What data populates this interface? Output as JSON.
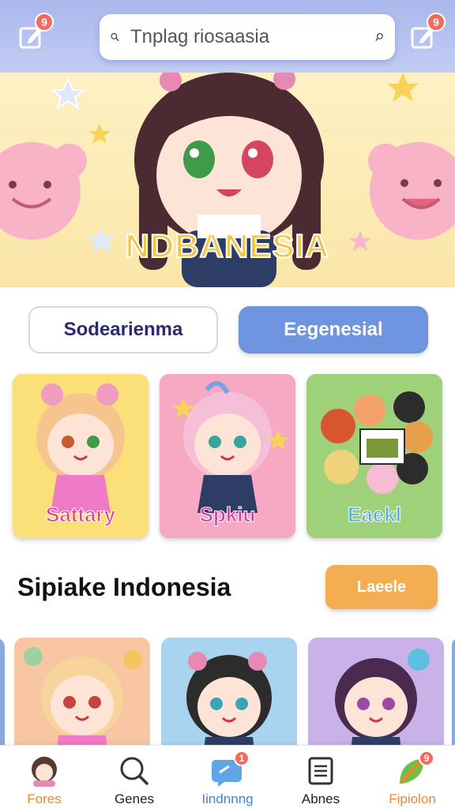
{
  "header": {
    "left_icon": "edit-icon",
    "left_badge": "9",
    "right_icon": "edit-icon",
    "right_badge": "9",
    "search_placeholder": "Tnplag riosaasia"
  },
  "banner": {
    "title": "NDBANESIA"
  },
  "tabs": [
    {
      "label": "Sodearienma",
      "active": false
    },
    {
      "label": "Eegenesial",
      "active": true
    }
  ],
  "featured": [
    {
      "label": "Sattary",
      "color": "#fbe07a"
    },
    {
      "label": "Spkiu",
      "color": "#f7a9c4"
    },
    {
      "label": "Eaekl",
      "color": "#9fd07a"
    }
  ],
  "section": {
    "title": "Sipiake Indonesia",
    "button": "Laeele"
  },
  "bottom_nav": [
    {
      "label": "Fores",
      "icon": "avatar-icon",
      "color": "#e88a2c"
    },
    {
      "label": "Genes",
      "icon": "search-icon",
      "color": "#222222"
    },
    {
      "label": "Iindnnng",
      "icon": "chat-icon",
      "color": "#3c86dc",
      "badge": "1"
    },
    {
      "label": "Abnes",
      "icon": "book-icon",
      "color": "#222222"
    },
    {
      "label": "Fipiolon",
      "icon": "leaf-icon",
      "color": "#e88a2c",
      "badge": "9"
    }
  ]
}
